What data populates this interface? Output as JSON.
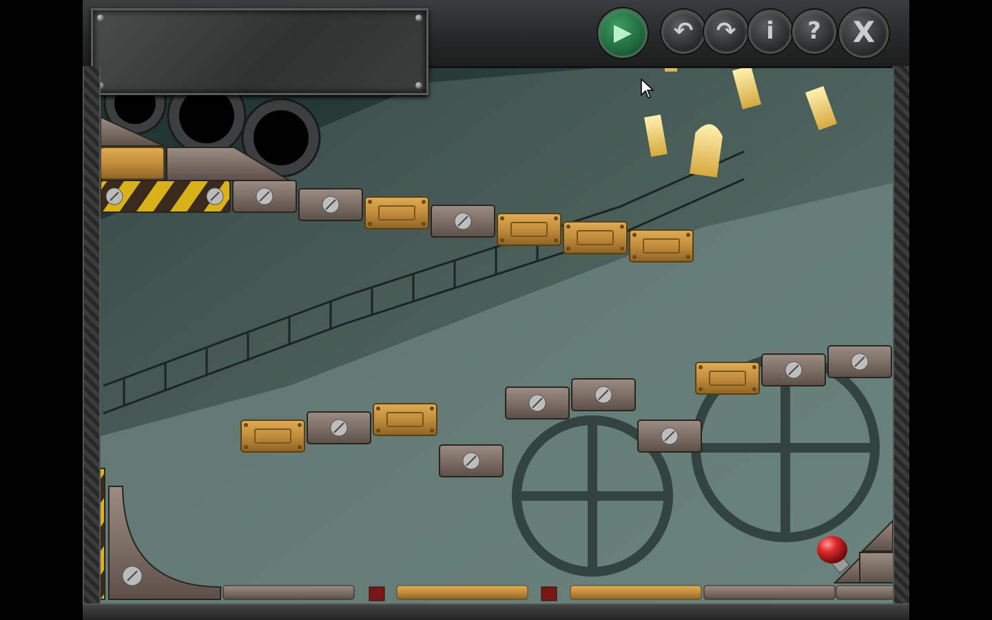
{
  "game": {
    "toolbar": [
      {
        "id": "play",
        "icon": "play-icon",
        "glyph": "▶"
      },
      {
        "id": "undo",
        "icon": "undo-icon",
        "glyph": "↶"
      },
      {
        "id": "redo",
        "icon": "redo-icon",
        "glyph": "↷"
      },
      {
        "id": "info",
        "icon": "info-icon",
        "glyph": "i"
      },
      {
        "id": "help",
        "icon": "help-icon",
        "glyph": "?"
      },
      {
        "id": "close",
        "icon": "close-icon",
        "glyph": "X"
      }
    ],
    "colors": {
      "background": "#2e4440",
      "wall": "#5c6f69",
      "brass": "#c28d3c",
      "steel": "#7e6f66",
      "hazard_yellow": "#d9b21a",
      "button_red": "#cc1f1f",
      "play_green": "#2f8450"
    },
    "status_text": ""
  }
}
